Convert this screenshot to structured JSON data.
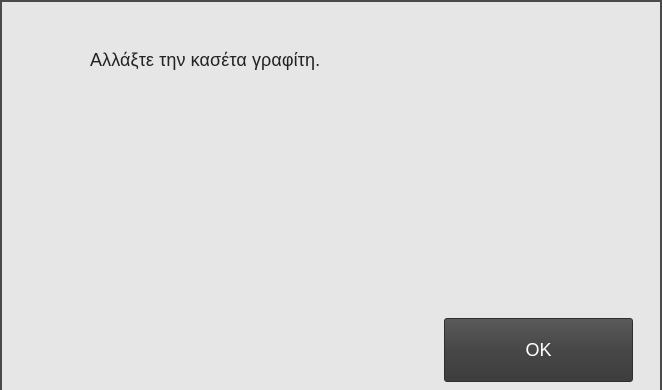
{
  "dialog": {
    "message": "Αλλάξτε την κασέτα γραφίτη.",
    "ok_label": "OK"
  }
}
